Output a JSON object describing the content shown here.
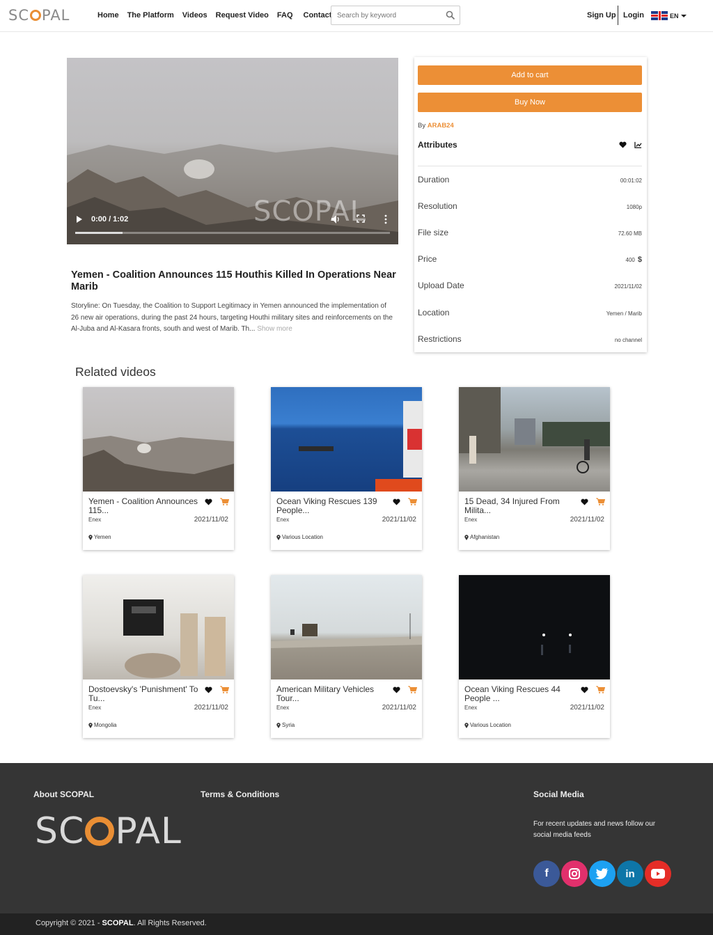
{
  "nav": {
    "logo": "SC PAL",
    "links": [
      "Home",
      "The Platform",
      "Videos",
      "Request Video",
      "FAQ",
      "Contact"
    ],
    "search_placeholder": "Search by keyword",
    "signup": "Sign Up",
    "login": "Login",
    "lang": "EN"
  },
  "video": {
    "time": "0:00 / 1:02",
    "progress": 0.15,
    "watermark": "SCOPAL"
  },
  "detail": {
    "title": "Yemen - Coalition Announces 115 Houthis Killed In Operations Near Marib",
    "storyline": "Storyline:  On Tuesday, the Coalition to Support Legitimacy in Yemen announced the implementation of 26 new air operations, during the past 24 hours, targeting Houthi military sites and reinforcements on the Al-Juba and Al-Kasara fronts, south and west of Marib. Th...",
    "show_more": "Show more"
  },
  "side": {
    "add_to_cart": "Add to cart",
    "buy_now": "Buy Now",
    "by_label": "By",
    "by_source": "ARAB24",
    "attributes_title": "Attributes",
    "attributes": [
      {
        "key": "Duration",
        "value": "00:01:02"
      },
      {
        "key": "Resolution",
        "value": "1080p"
      },
      {
        "key": "File size",
        "value": "72.60 MB"
      },
      {
        "key": "Price",
        "value": "400"
      },
      {
        "key": "Upload Date",
        "value": "2021/11/02"
      },
      {
        "key": "Location",
        "value": "Yemen / Marib"
      },
      {
        "key": "Restrictions",
        "value": "no channel"
      }
    ],
    "currency": "$"
  },
  "related": {
    "title": "Related videos",
    "items": [
      {
        "title": "Yemen - Coalition Announces 115...",
        "source": "Enex",
        "date": "2021/11/02",
        "location": "Yemen"
      },
      {
        "title": "Ocean Viking Rescues 139 People...",
        "source": "Enex",
        "date": "2021/11/02",
        "location": "Various Location"
      },
      {
        "title": "15 Dead, 34 Injured From Milita...",
        "source": "Enex",
        "date": "2021/11/02",
        "location": "Afghanistan"
      },
      {
        "title": "Dostoevsky's 'Punishment' To Tu...",
        "source": "Enex",
        "date": "2021/11/02",
        "location": "Mongolia"
      },
      {
        "title": "American Military Vehicles Tour...",
        "source": "Enex",
        "date": "2021/11/02",
        "location": "Syria"
      },
      {
        "title": "Ocean Viking Rescues 44 People ...",
        "source": "Enex",
        "date": "2021/11/02",
        "location": "Various Location"
      }
    ]
  },
  "footer": {
    "about": "About SCOPAL",
    "terms": "Terms & Conditions",
    "social_title": "Social Media",
    "social_text": "For recent updates and news follow our social media feeds",
    "logo": "SC PAL",
    "social": [
      "facebook",
      "instagram",
      "twitter",
      "linkedin",
      "youtube"
    ],
    "copyright_pre": "Copyright © 2021 - ",
    "copyright_brand": "SCOPAL",
    "copyright_post": ". All Rights Reserved."
  },
  "colors": {
    "accent": "#ec8f36",
    "footer_bg": "#353535",
    "facebook": "#3b5998",
    "instagram": "#e1306c",
    "twitter": "#1da1f2",
    "linkedin": "#0e76a8",
    "youtube": "#e52d27"
  }
}
